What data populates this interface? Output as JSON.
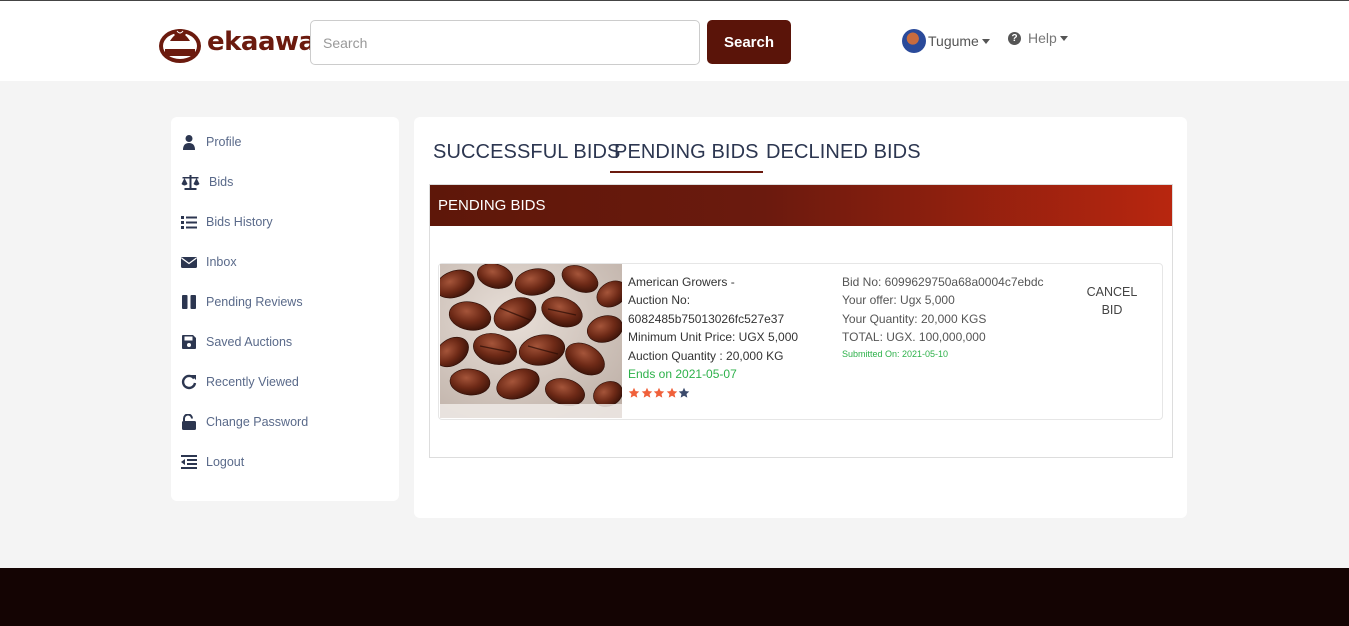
{
  "header": {
    "brand": "ekaawa",
    "logo_sub": "ekaawa",
    "search_placeholder": "Search",
    "search_button": "Search",
    "user_name": "Tugume",
    "help_label": "Help"
  },
  "sidebar": {
    "items": [
      {
        "label": "Profile",
        "icon": "user-icon"
      },
      {
        "label": "Bids",
        "icon": "scale-icon"
      },
      {
        "label": "Bids History",
        "icon": "list-icon"
      },
      {
        "label": "Inbox",
        "icon": "envelope-icon"
      },
      {
        "label": "Pending Reviews",
        "icon": "pause-icon"
      },
      {
        "label": "Saved Auctions",
        "icon": "save-icon"
      },
      {
        "label": "Recently Viewed",
        "icon": "redo-icon"
      },
      {
        "label": "Change Password",
        "icon": "unlock-icon"
      },
      {
        "label": "Logout",
        "icon": "outdent-icon"
      }
    ]
  },
  "tabs": [
    {
      "label": "SUCCESSFUL BIDS",
      "active": false
    },
    {
      "label": "PENDING BIDS",
      "active": true
    },
    {
      "label": "DECLINED BIDS",
      "active": false
    }
  ],
  "panel": {
    "title": "PENDING BIDS",
    "bid": {
      "seller": "American Growers -",
      "auction_no_label": "Auction No:",
      "auction_no": "6082485b75013026fc527e37",
      "min_unit_price": "Minimum Unit Price: UGX 5,000",
      "auction_quantity": "Auction Quantity : 20,000 KG",
      "ends_on": "Ends on 2021-05-07",
      "rating": 4,
      "rating_max": 5,
      "bid_no": "Bid No: 6099629750a68a0004c7ebdc",
      "your_offer": "Your offer: Ugx 5,000",
      "your_quantity": "Your Quantity: 20,000 KGS",
      "total": "TOTAL: UGX. 100,000,000",
      "submitted_on": "Submitted On: 2021-05-10",
      "cancel_line1": "CANCEL",
      "cancel_line2": "BID"
    }
  },
  "colors": {
    "brand": "#6b1a0e",
    "button": "#5a1409",
    "header_gradient_end": "#b8260f",
    "green": "#2db14a",
    "star_filled": "#f0603a",
    "star_empty": "#3b4a6b",
    "footer": "#140403"
  }
}
